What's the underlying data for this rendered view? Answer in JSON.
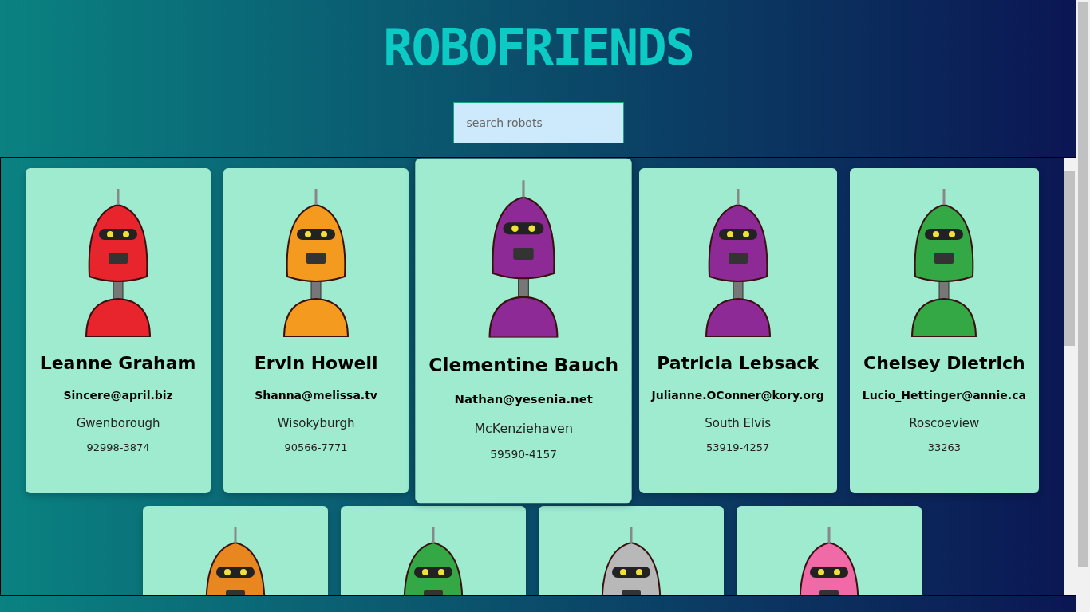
{
  "title": "ROBOFRIENDS",
  "search": {
    "placeholder": "search robots"
  },
  "robots": [
    {
      "name": "Leanne Graham",
      "email": "Sincere@april.biz",
      "city": "Gwenborough",
      "zipcode": "92998-3874",
      "color": "#e8242c",
      "hovered": false
    },
    {
      "name": "Ervin Howell",
      "email": "Shanna@melissa.tv",
      "city": "Wisokyburgh",
      "zipcode": "90566-7771",
      "color": "#f39a1f",
      "hovered": false
    },
    {
      "name": "Clementine Bauch",
      "email": "Nathan@yesenia.net",
      "city": "McKenziehaven",
      "zipcode": "59590-4157",
      "color": "#8e2a96",
      "hovered": true
    },
    {
      "name": "Patricia Lebsack",
      "email": "Julianne.OConner@kory.org",
      "city": "South Elvis",
      "zipcode": "53919-4257",
      "color": "#8e2a96",
      "hovered": false
    },
    {
      "name": "Chelsey Dietrich",
      "email": "Lucio_Hettinger@annie.ca",
      "city": "Roscoeview",
      "zipcode": "33263",
      "color": "#33a845",
      "hovered": false
    },
    {
      "color": "#e8861f",
      "hovered": false
    },
    {
      "color": "#33a845",
      "hovered": false
    },
    {
      "color": "#b8b8b8",
      "hovered": false
    },
    {
      "color": "#f06aa8",
      "hovered": false
    }
  ]
}
